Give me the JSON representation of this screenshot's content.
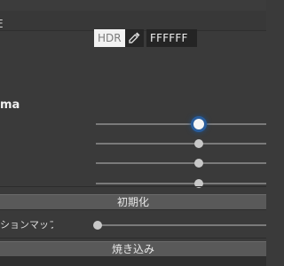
{
  "color_row": {
    "label_fragment": "E",
    "hdr_label": "HDR",
    "eyedropper_icon": "eyedropper-icon",
    "hex_value": "FFFFFF"
  },
  "gamma": {
    "label_fragment": "ma"
  },
  "sliders": [
    {
      "value": 0.6,
      "active": true
    },
    {
      "value": 0.6,
      "active": false
    },
    {
      "value": 0.6,
      "active": false
    },
    {
      "value": 0.6,
      "active": false
    }
  ],
  "reset_button": {
    "label": "初期化"
  },
  "toggle_row": {
    "label_fragment": "ションマップ",
    "slider_value": 0.0
  },
  "bake_button": {
    "label": "焼き込み"
  },
  "colors": {
    "panel_bg": "#3a3a3a",
    "slider_active_glow": "#2a5d9b",
    "button_bg": "#595959"
  }
}
